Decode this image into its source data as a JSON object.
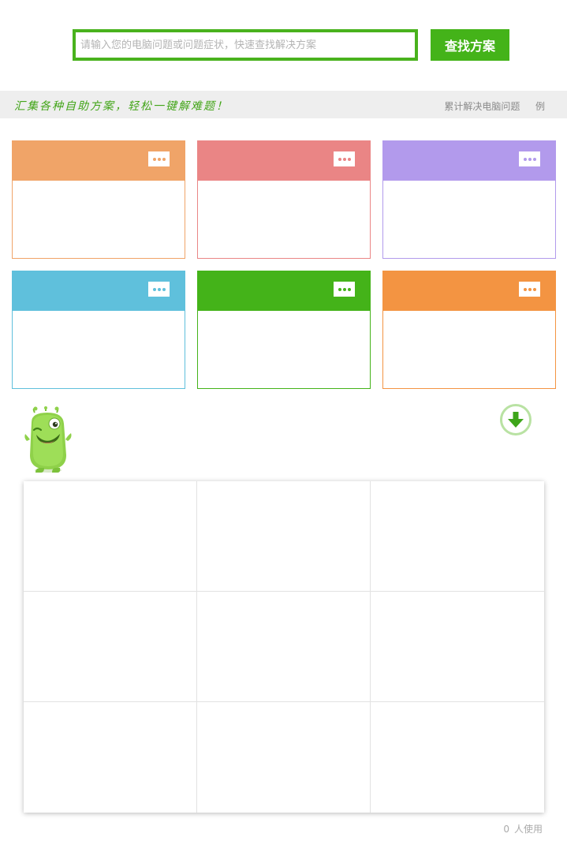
{
  "search": {
    "placeholder": "请输入您的电脑问题或问题症状，快速查找解决方案",
    "value": "",
    "button_label": "查找方案"
  },
  "banner": {
    "slogan": "汇集各种自助方案，轻松一键解难题！",
    "stat_label": "累计解决电脑问题",
    "stat_count": "",
    "stat_unit": "例"
  },
  "categories": [
    {
      "color": "#f0a468",
      "icon": "more-dots-icon"
    },
    {
      "color": "#ea8585",
      "icon": "more-dots-icon"
    },
    {
      "color": "#b29aec",
      "icon": "more-dots-icon"
    },
    {
      "color": "#5fc0dc",
      "icon": "more-dots-icon"
    },
    {
      "color": "#44b319",
      "icon": "more-dots-icon"
    },
    {
      "color": "#f39442",
      "icon": "more-dots-icon"
    }
  ],
  "tools": {
    "mascot_icon": "green-monster-mascot-icon",
    "toggle_icon": "arrow-down-circle-icon",
    "cells": [
      {},
      {},
      {},
      {},
      {},
      {},
      {},
      {},
      {}
    ]
  },
  "footer": {
    "user_count": "0",
    "user_label": "人使用"
  },
  "colors": {
    "accent": "#44b319",
    "banner_bg": "#eeeeee"
  }
}
